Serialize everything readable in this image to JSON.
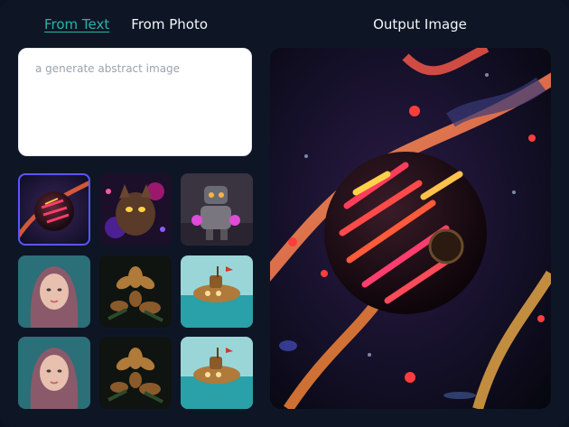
{
  "tabs": [
    {
      "label": "From Text",
      "active": true
    },
    {
      "label": "From Photo",
      "active": false
    }
  ],
  "prompt": {
    "placeholder": "a generate abstract image",
    "value": ""
  },
  "output": {
    "title": "Output Image"
  },
  "thumbnails": [
    {
      "subject": "abstract-sphere",
      "selected": true
    },
    {
      "subject": "neon-cat",
      "selected": false
    },
    {
      "subject": "robot",
      "selected": false
    },
    {
      "subject": "woman-portrait",
      "selected": false
    },
    {
      "subject": "metal-flowers",
      "selected": false
    },
    {
      "subject": "submarine",
      "selected": false
    },
    {
      "subject": "woman-portrait",
      "selected": false
    },
    {
      "subject": "metal-flowers",
      "selected": false
    },
    {
      "subject": "submarine",
      "selected": false
    }
  ],
  "colors": {
    "background": "#0e1626",
    "active_tab": "#2bb3a6",
    "selected_outline": "#5b55ff"
  }
}
